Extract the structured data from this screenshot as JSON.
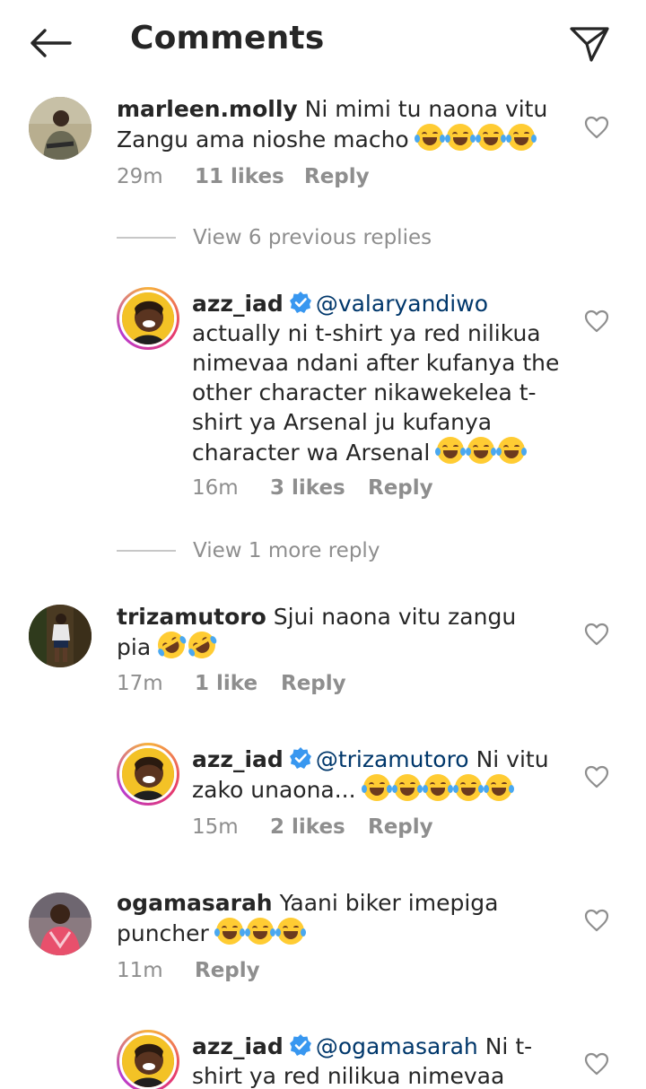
{
  "header": {
    "title": "Comments"
  },
  "comments": [
    {
      "username": "marleen.molly",
      "text": "Ni mimi tu naona vitu Zangu ama nioshe macho",
      "emoji_count": 4,
      "time": "29m",
      "likes": "11 likes",
      "reply_label": "Reply"
    },
    {
      "view_replies": "View 6 previous replies"
    },
    {
      "username": "azz_iad",
      "mention": "@valaryandiwo",
      "text": "actually ni t-shirt ya red nilikua nimevaa ndani after kufanya the other character nikawekelea t-shirt  ya Arsenal ju kufanya character wa Arsenal",
      "emoji_count": 3,
      "time": "16m",
      "likes": "3 likes",
      "reply_label": "Reply"
    },
    {
      "view_replies": "View 1 more reply"
    },
    {
      "username": "trizamutoro",
      "text": "Sjui naona vitu zangu pia",
      "emoji_count": 2,
      "time": "17m",
      "likes": "1 like",
      "reply_label": "Reply"
    },
    {
      "username": "azz_iad",
      "mention": "@trizamutoro",
      "text": "Ni vitu zako unaona...",
      "emoji_count": 5,
      "time": "15m",
      "likes": "2 likes",
      "reply_label": "Reply"
    },
    {
      "username": "ogamasarah",
      "text": "Yaani biker imepiga puncher",
      "emoji_count": 3,
      "time": "11m",
      "reply_label": "Reply"
    },
    {
      "username": "azz_iad",
      "mention": "@ogamasarah",
      "text": "Ni t-shirt ya red nilikua nimevaa"
    }
  ],
  "colors": {
    "accent_verified": "#3897f0",
    "mention": "#00376b",
    "muted": "#8e8e8e"
  },
  "icons": {
    "back": "arrow-left-icon",
    "send": "paper-plane-icon",
    "like": "heart-outline-icon",
    "verified": "verified-badge-icon"
  }
}
